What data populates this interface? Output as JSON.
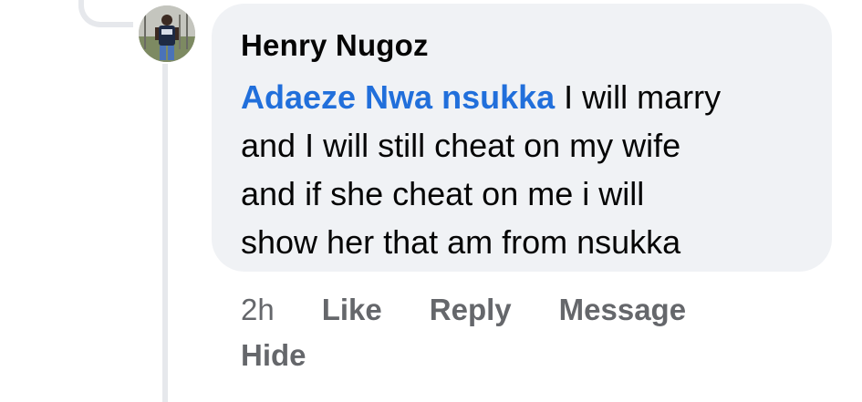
{
  "comment": {
    "author": "Henry Nugoz",
    "mention": "Adaeze Nwa nsukka",
    "text_line1": " I will marry",
    "text_line2": "and I will still cheat on my wife",
    "text_line3": "and if she cheat on me i will",
    "text_line4": "show her that am from nsukka",
    "mention_color": "#216fdb",
    "bubble_color": "#f0f2f5"
  },
  "actions": {
    "time": "2h",
    "like_label": "Like",
    "reply_label": "Reply",
    "message_label": "Message",
    "hide_label": "Hide",
    "color": "#65676b"
  },
  "avatar": {
    "icon": "user-photo-avatar"
  }
}
